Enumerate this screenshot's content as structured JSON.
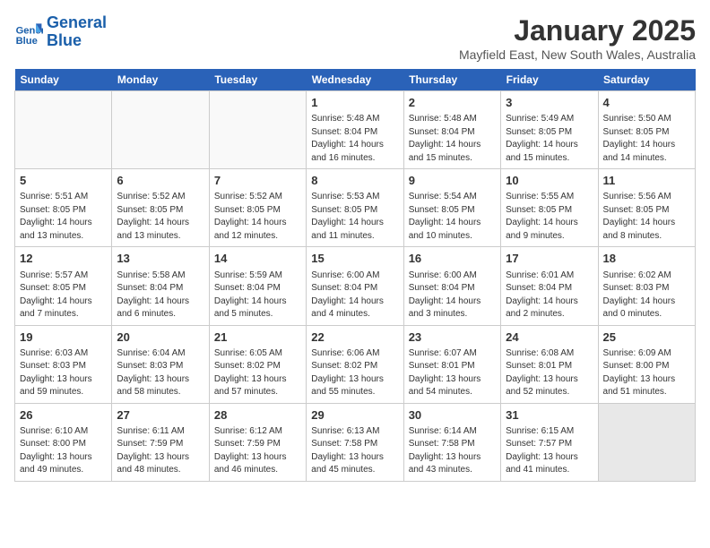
{
  "header": {
    "logo_line1": "General",
    "logo_line2": "Blue",
    "month": "January 2025",
    "location": "Mayfield East, New South Wales, Australia"
  },
  "weekdays": [
    "Sunday",
    "Monday",
    "Tuesday",
    "Wednesday",
    "Thursday",
    "Friday",
    "Saturday"
  ],
  "weeks": [
    [
      {
        "day": "",
        "content": ""
      },
      {
        "day": "",
        "content": ""
      },
      {
        "day": "",
        "content": ""
      },
      {
        "day": "1",
        "content": "Sunrise: 5:48 AM\nSunset: 8:04 PM\nDaylight: 14 hours\nand 16 minutes."
      },
      {
        "day": "2",
        "content": "Sunrise: 5:48 AM\nSunset: 8:04 PM\nDaylight: 14 hours\nand 15 minutes."
      },
      {
        "day": "3",
        "content": "Sunrise: 5:49 AM\nSunset: 8:05 PM\nDaylight: 14 hours\nand 15 minutes."
      },
      {
        "day": "4",
        "content": "Sunrise: 5:50 AM\nSunset: 8:05 PM\nDaylight: 14 hours\nand 14 minutes."
      }
    ],
    [
      {
        "day": "5",
        "content": "Sunrise: 5:51 AM\nSunset: 8:05 PM\nDaylight: 14 hours\nand 13 minutes."
      },
      {
        "day": "6",
        "content": "Sunrise: 5:52 AM\nSunset: 8:05 PM\nDaylight: 14 hours\nand 13 minutes."
      },
      {
        "day": "7",
        "content": "Sunrise: 5:52 AM\nSunset: 8:05 PM\nDaylight: 14 hours\nand 12 minutes."
      },
      {
        "day": "8",
        "content": "Sunrise: 5:53 AM\nSunset: 8:05 PM\nDaylight: 14 hours\nand 11 minutes."
      },
      {
        "day": "9",
        "content": "Sunrise: 5:54 AM\nSunset: 8:05 PM\nDaylight: 14 hours\nand 10 minutes."
      },
      {
        "day": "10",
        "content": "Sunrise: 5:55 AM\nSunset: 8:05 PM\nDaylight: 14 hours\nand 9 minutes."
      },
      {
        "day": "11",
        "content": "Sunrise: 5:56 AM\nSunset: 8:05 PM\nDaylight: 14 hours\nand 8 minutes."
      }
    ],
    [
      {
        "day": "12",
        "content": "Sunrise: 5:57 AM\nSunset: 8:05 PM\nDaylight: 14 hours\nand 7 minutes."
      },
      {
        "day": "13",
        "content": "Sunrise: 5:58 AM\nSunset: 8:04 PM\nDaylight: 14 hours\nand 6 minutes."
      },
      {
        "day": "14",
        "content": "Sunrise: 5:59 AM\nSunset: 8:04 PM\nDaylight: 14 hours\nand 5 minutes."
      },
      {
        "day": "15",
        "content": "Sunrise: 6:00 AM\nSunset: 8:04 PM\nDaylight: 14 hours\nand 4 minutes."
      },
      {
        "day": "16",
        "content": "Sunrise: 6:00 AM\nSunset: 8:04 PM\nDaylight: 14 hours\nand 3 minutes."
      },
      {
        "day": "17",
        "content": "Sunrise: 6:01 AM\nSunset: 8:04 PM\nDaylight: 14 hours\nand 2 minutes."
      },
      {
        "day": "18",
        "content": "Sunrise: 6:02 AM\nSunset: 8:03 PM\nDaylight: 14 hours\nand 0 minutes."
      }
    ],
    [
      {
        "day": "19",
        "content": "Sunrise: 6:03 AM\nSunset: 8:03 PM\nDaylight: 13 hours\nand 59 minutes."
      },
      {
        "day": "20",
        "content": "Sunrise: 6:04 AM\nSunset: 8:03 PM\nDaylight: 13 hours\nand 58 minutes."
      },
      {
        "day": "21",
        "content": "Sunrise: 6:05 AM\nSunset: 8:02 PM\nDaylight: 13 hours\nand 57 minutes."
      },
      {
        "day": "22",
        "content": "Sunrise: 6:06 AM\nSunset: 8:02 PM\nDaylight: 13 hours\nand 55 minutes."
      },
      {
        "day": "23",
        "content": "Sunrise: 6:07 AM\nSunset: 8:01 PM\nDaylight: 13 hours\nand 54 minutes."
      },
      {
        "day": "24",
        "content": "Sunrise: 6:08 AM\nSunset: 8:01 PM\nDaylight: 13 hours\nand 52 minutes."
      },
      {
        "day": "25",
        "content": "Sunrise: 6:09 AM\nSunset: 8:00 PM\nDaylight: 13 hours\nand 51 minutes."
      }
    ],
    [
      {
        "day": "26",
        "content": "Sunrise: 6:10 AM\nSunset: 8:00 PM\nDaylight: 13 hours\nand 49 minutes."
      },
      {
        "day": "27",
        "content": "Sunrise: 6:11 AM\nSunset: 7:59 PM\nDaylight: 13 hours\nand 48 minutes."
      },
      {
        "day": "28",
        "content": "Sunrise: 6:12 AM\nSunset: 7:59 PM\nDaylight: 13 hours\nand 46 minutes."
      },
      {
        "day": "29",
        "content": "Sunrise: 6:13 AM\nSunset: 7:58 PM\nDaylight: 13 hours\nand 45 minutes."
      },
      {
        "day": "30",
        "content": "Sunrise: 6:14 AM\nSunset: 7:58 PM\nDaylight: 13 hours\nand 43 minutes."
      },
      {
        "day": "31",
        "content": "Sunrise: 6:15 AM\nSunset: 7:57 PM\nDaylight: 13 hours\nand 41 minutes."
      },
      {
        "day": "",
        "content": ""
      }
    ]
  ]
}
